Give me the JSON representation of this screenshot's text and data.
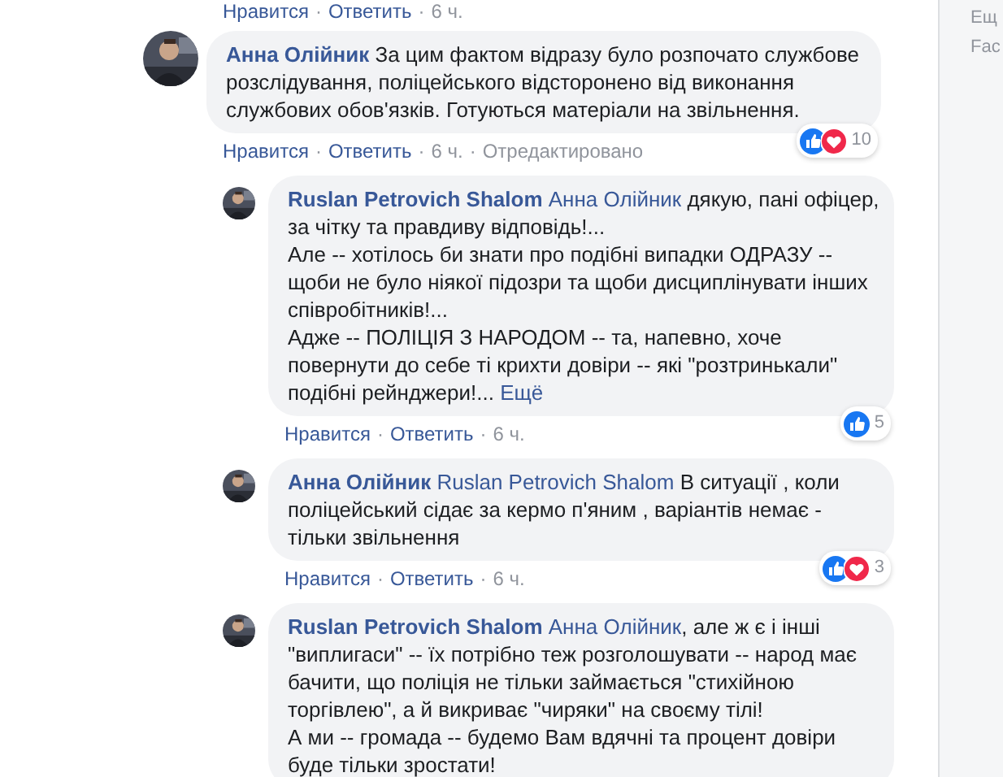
{
  "separator": "·",
  "top_actions": [
    {
      "kind": "link",
      "text": "Нравится"
    },
    {
      "kind": "link",
      "text": "Ответить"
    },
    {
      "kind": "meta",
      "text": "6 ч."
    }
  ],
  "comments": [
    {
      "author": "Анна Олійник",
      "text": "За цим фактом відразу було розпочато службове розслідування, поліцейського відсторонено від виконання службових обов'язків. Готуються матеріали на звільнення.",
      "reactions": {
        "like": true,
        "love": true,
        "count": "10"
      },
      "actions": [
        {
          "kind": "link",
          "text": "Нравится"
        },
        {
          "kind": "link",
          "text": "Ответить"
        },
        {
          "kind": "meta",
          "text": "6 ч."
        },
        {
          "kind": "meta",
          "text": "Отредактировано"
        }
      ],
      "children": [
        {
          "author": "Ruslan Petrovich Shalom",
          "mention": "Анна Олійник",
          "text": "дякую, пані офіцер, за чітку та правдиву відповідь!...\nАле -- хотілось би знати про подібні випадки ОДРАЗУ -- щоби не було ніякої підозри та щоби дисциплінувати інших співробітників!...\nАдже -- ПОЛІЦІЯ З НАРОДОМ -- та, напевно, хоче повернути до себе ті крихти довіри -- які \"розтринькали\" подібні рейнджери!...",
          "more": "Ещё",
          "reactions": {
            "like": true,
            "love": false,
            "count": "5"
          },
          "actions": [
            {
              "kind": "link",
              "text": "Нравится"
            },
            {
              "kind": "link",
              "text": "Ответить"
            },
            {
              "kind": "meta",
              "text": "6 ч."
            }
          ]
        },
        {
          "author": "Анна Олійник",
          "mention": "Ruslan Petrovich Shalom",
          "text": "В ситуації , коли поліцейський сідає за кермо п'яним , варіантів немає - тільки звільнення",
          "reactions": {
            "like": true,
            "love": true,
            "count": "3"
          },
          "actions": [
            {
              "kind": "link",
              "text": "Нравится"
            },
            {
              "kind": "link",
              "text": "Ответить"
            },
            {
              "kind": "meta",
              "text": "6 ч."
            }
          ]
        },
        {
          "author": "Ruslan Petrovich Shalom",
          "mention": "Анна Олійник",
          "text": ", але ж є і інші \"виплигаси\" -- їх потрібно теж розголошувати -- народ має бачити, що поліція не тільки займається \"стихійною торгівлею\", а й викриває \"чиряки\" на своєму тілі!\nА ми -- громада -- будемо Вам вдячні та процент довіри буде тільки зростати!"
        }
      ]
    }
  ],
  "sidebar": {
    "lines": [
      "Ещ",
      "Fac"
    ]
  }
}
